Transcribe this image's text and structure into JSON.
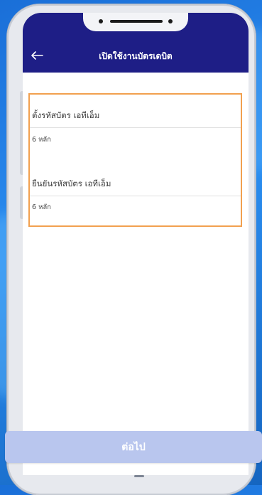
{
  "header": {
    "title": "เปิดใช้งานบัตรเดบิต",
    "back_icon": "arrow-left-icon"
  },
  "form": {
    "set_pin_label": "ตั้งรหัสบัตร เอทีเอ็ม",
    "set_pin_placeholder": "6 หลัก",
    "confirm_pin_label": "ยืนยันรหัสบัตร เอทีเอ็ม",
    "confirm_pin_placeholder": "6 หลัก",
    "highlight_color": "#f2a04f"
  },
  "footer": {
    "next_label": "ต่อไป",
    "button_color": "#b9c6ee"
  },
  "colors": {
    "header_bg": "#1e1e86",
    "background": "#1a6fd8"
  }
}
